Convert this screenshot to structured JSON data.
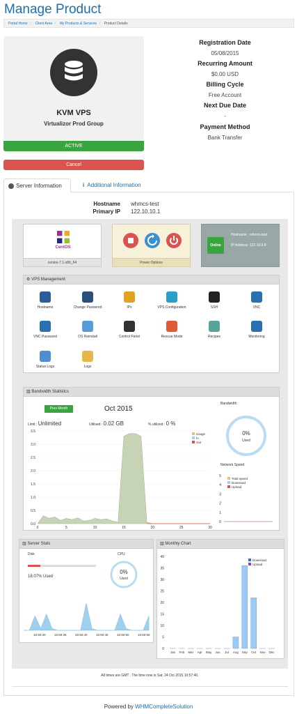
{
  "page": {
    "title": "Manage Product"
  },
  "breadcrumb": [
    "Portal Home",
    "Client Area",
    "My Products & Services",
    "Product Details"
  ],
  "product": {
    "name": "KVM VPS",
    "group": "Virtualizor Prod Group",
    "status": "ACTIVE",
    "cancel_label": "Cancel",
    "icon": "database-icon"
  },
  "details": {
    "registration_label": "Registration Date",
    "registration_value": "05/08/2015",
    "recurring_label": "Recurring Amount",
    "recurring_value": "$0.00 USD",
    "billing_label": "Billing Cycle",
    "billing_value": "Free Account",
    "next_due_label": "Next Due Date",
    "next_due_value": "-",
    "payment_label": "Payment Method",
    "payment_value": "Bank Transfer"
  },
  "tabs": [
    {
      "label": "Server Information",
      "icon": "globe-icon",
      "active": true
    },
    {
      "label": "Additional Information",
      "icon": "info-icon",
      "active": false
    }
  ],
  "server": {
    "hostname_label": "Hostname",
    "hostname_value": "whmcs-test",
    "ip_label": "Primary IP",
    "ip_value": "122.10.10.1"
  },
  "vps_panel": {
    "os_logo_text": "CentOS",
    "os_label": "centos-7.1-x86_64",
    "power_label": "Power Options",
    "online_status": "Online",
    "online_hostname": "Hostname : whmcs-test",
    "online_ip": "IP Address: 122.10.9.8"
  },
  "management": {
    "title": "VPS Management",
    "items": [
      {
        "label": "Hostname",
        "icon": "monitor-icon",
        "color": "#2b5d9b"
      },
      {
        "label": "Change Password",
        "icon": "key-icon",
        "color": "#2a4f7a"
      },
      {
        "label": "IPs",
        "icon": "network-icon",
        "color": "#e0a21f"
      },
      {
        "label": "VPS Configuration",
        "icon": "wrench-icon",
        "color": "#2aa0c8"
      },
      {
        "label": "SSH",
        "icon": "terminal-icon",
        "color": "#222222"
      },
      {
        "label": "VNC",
        "icon": "vnc-icon",
        "color": "#2a6fb0"
      },
      {
        "label": "VNC Password",
        "icon": "vnc-password-icon",
        "color": "#2a6fb0"
      },
      {
        "label": "OS Reinstall",
        "icon": "reinstall-icon",
        "color": "#5b9bd5"
      },
      {
        "label": "Control Panel",
        "icon": "control-panel-icon",
        "color": "#333333"
      },
      {
        "label": "Rescue Mode",
        "icon": "lifebuoy-icon",
        "color": "#e05a3a"
      },
      {
        "label": "Recipes",
        "icon": "chef-icon",
        "color": "#5aa39a"
      },
      {
        "label": "Monitoring",
        "icon": "monitoring-icon",
        "color": "#2a6fb0"
      },
      {
        "label": "Status Logs",
        "icon": "status-logs-icon",
        "color": "#4f8fd0"
      },
      {
        "label": "Logs",
        "icon": "logs-icon",
        "color": "#e6b84a"
      }
    ]
  },
  "bandwidth": {
    "title": "Bandwidth Statistics",
    "prev_label": "Prev Month",
    "month": "Oct 2015",
    "limit_label": "Limit :",
    "limit_value": "Unlimited",
    "utilised_label": "Utilised :",
    "utilised_value": "0.02 GB",
    "percent_label": "% utilized :",
    "percent_value": "0 %",
    "side_title": "Bandwidth",
    "donut_value": "0%",
    "donut_caption": "Used",
    "network_title": "Network Speed",
    "colors": {
      "usage": "#e9c17a",
      "in": "#9fd0ee",
      "out": "#d9534f",
      "area": "#c6d3b4"
    }
  },
  "server_stats": {
    "title": "Server Stats",
    "disk_label": "Disk",
    "disk_used": "18.07% Used",
    "cpu_label": "CPU",
    "cpu_value": "0%",
    "cpu_caption": "Used"
  },
  "monthly": {
    "title": "Monthly Chart"
  },
  "chart_data": [
    {
      "type": "area",
      "series": [
        {
          "name": "Usage",
          "values": [
            0.0,
            0.3,
            0.2,
            0.25,
            0.12,
            0.2,
            0.15,
            0.22,
            0.1,
            0.12,
            0.2,
            0.15,
            0.18,
            0.1,
            0.05,
            3.3,
            3.4,
            3.4,
            3.3,
            0.05,
            0.0,
            0.0,
            0.0,
            0.0,
            0.0,
            0.0,
            0.0,
            0.0,
            0.0,
            0.0,
            0.0
          ]
        },
        {
          "name": "In"
        },
        {
          "name": "Out"
        }
      ],
      "x": [
        0,
        1,
        2,
        3,
        4,
        5,
        6,
        7,
        8,
        9,
        10,
        11,
        12,
        13,
        14,
        15,
        16,
        17,
        18,
        19,
        20,
        21,
        22,
        23,
        24,
        25,
        26,
        27,
        28,
        29,
        30
      ],
      "xticks": [
        "0",
        "5",
        "10",
        "15",
        "20",
        "25",
        "30"
      ],
      "yticks": [
        "0.0",
        "0.5",
        "1.0",
        "1.5",
        "2.0",
        "2.5",
        "3.0",
        "3.5"
      ],
      "xlim": [
        0,
        30
      ],
      "ylim": [
        0,
        3.5
      ]
    },
    {
      "type": "line",
      "series": [
        {
          "name": "Total speed",
          "values": [
            0,
            0,
            0,
            0,
            0,
            0,
            0,
            0
          ]
        },
        {
          "name": "Download"
        },
        {
          "name": "Upload"
        }
      ],
      "yticks": [
        "0",
        "1",
        "2",
        "3",
        "4",
        "5"
      ],
      "ylim": [
        0,
        5
      ]
    },
    {
      "type": "area",
      "x": [
        "16:50:30",
        "16:50:35",
        "16:50:40",
        "16:50:45",
        "16:50:50",
        "16:50:55"
      ],
      "series": [
        {
          "values": [
            0,
            0,
            0.8,
            0.1,
            0.9,
            0.1,
            0,
            0,
            0,
            0,
            0,
            1.5,
            0.1,
            0,
            0,
            0,
            0,
            0.9,
            0.1,
            0,
            0,
            0,
            0.8
          ]
        }
      ],
      "ylim": [
        0,
        2
      ]
    },
    {
      "type": "bar",
      "categories": [
        "Jan",
        "Feb",
        "Mar",
        "Apr",
        "May",
        "Jun",
        "Jul",
        "Aug",
        "Sep",
        "Oct",
        "Nov",
        "Dec"
      ],
      "series": [
        {
          "name": "Download",
          "values": [
            0,
            0,
            0,
            0,
            0,
            0,
            0,
            5,
            36,
            22,
            0,
            0
          ]
        },
        {
          "name": "Upload",
          "values": [
            0,
            0,
            0,
            0,
            0,
            0,
            0,
            0,
            0,
            0,
            0,
            0
          ]
        }
      ],
      "yticks": [
        "0",
        "5",
        "10",
        "15",
        "20",
        "25",
        "30",
        "35",
        "40"
      ],
      "ylim": [
        0,
        40
      ]
    }
  ],
  "footer": {
    "time_note": "All times are GMT . The time now is Sat, 24 Oct 2015 10:57:40.",
    "powered_prefix": "Powered by",
    "powered_link": "WHMCompleteSolution"
  }
}
